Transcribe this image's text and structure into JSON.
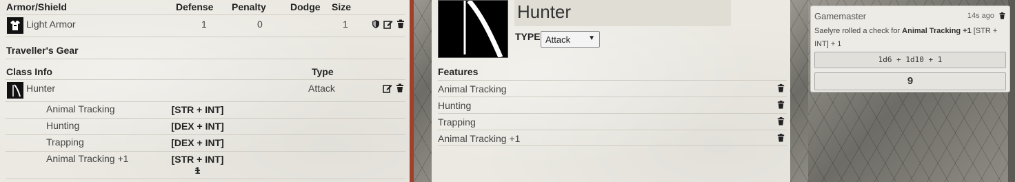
{
  "armor": {
    "headers": {
      "name": "Armor/Shield",
      "defense": "Defense",
      "penalty": "Penalty",
      "dodge": "Dodge",
      "size": "Size"
    },
    "items": [
      {
        "name": "Light Armor",
        "defense": "1",
        "penalty": "0",
        "dodge": "",
        "size": "1"
      }
    ]
  },
  "travellers_gear": {
    "label": "Traveller's Gear"
  },
  "class_info": {
    "headers": {
      "name": "Class Info",
      "type": "Type"
    },
    "class": {
      "name": "Hunter",
      "type": "Attack"
    },
    "features": [
      {
        "name": "Animal Tracking",
        "stat": "[STR + INT]"
      },
      {
        "name": "Hunting",
        "stat": "[DEX + INT]"
      },
      {
        "name": "Trapping",
        "stat": "[DEX + INT]"
      },
      {
        "name": "Animal Tracking +1",
        "stat_line1": "[STR + INT] +",
        "stat_line2": "1"
      }
    ]
  },
  "detail": {
    "title": "Hunter",
    "type_label": "TYPE",
    "type_value": "Attack",
    "features_label": "Features",
    "features": [
      "Animal Tracking",
      "Hunting",
      "Trapping",
      "Animal Tracking +1"
    ]
  },
  "chat": {
    "who": "Gamemaster",
    "time": "14s ago",
    "msg_prefix": "Saelyre rolled a check for ",
    "msg_bold": "Animal Tracking +1",
    "msg_suffix": " [STR + INT] + 1",
    "formula": "1d6 + 1d10 + 1",
    "total": "9"
  },
  "icons": {
    "shield": "shield-icon",
    "edit": "edit-icon",
    "trash": "trash-icon",
    "armor": "armor-icon",
    "class": "class-icon"
  }
}
